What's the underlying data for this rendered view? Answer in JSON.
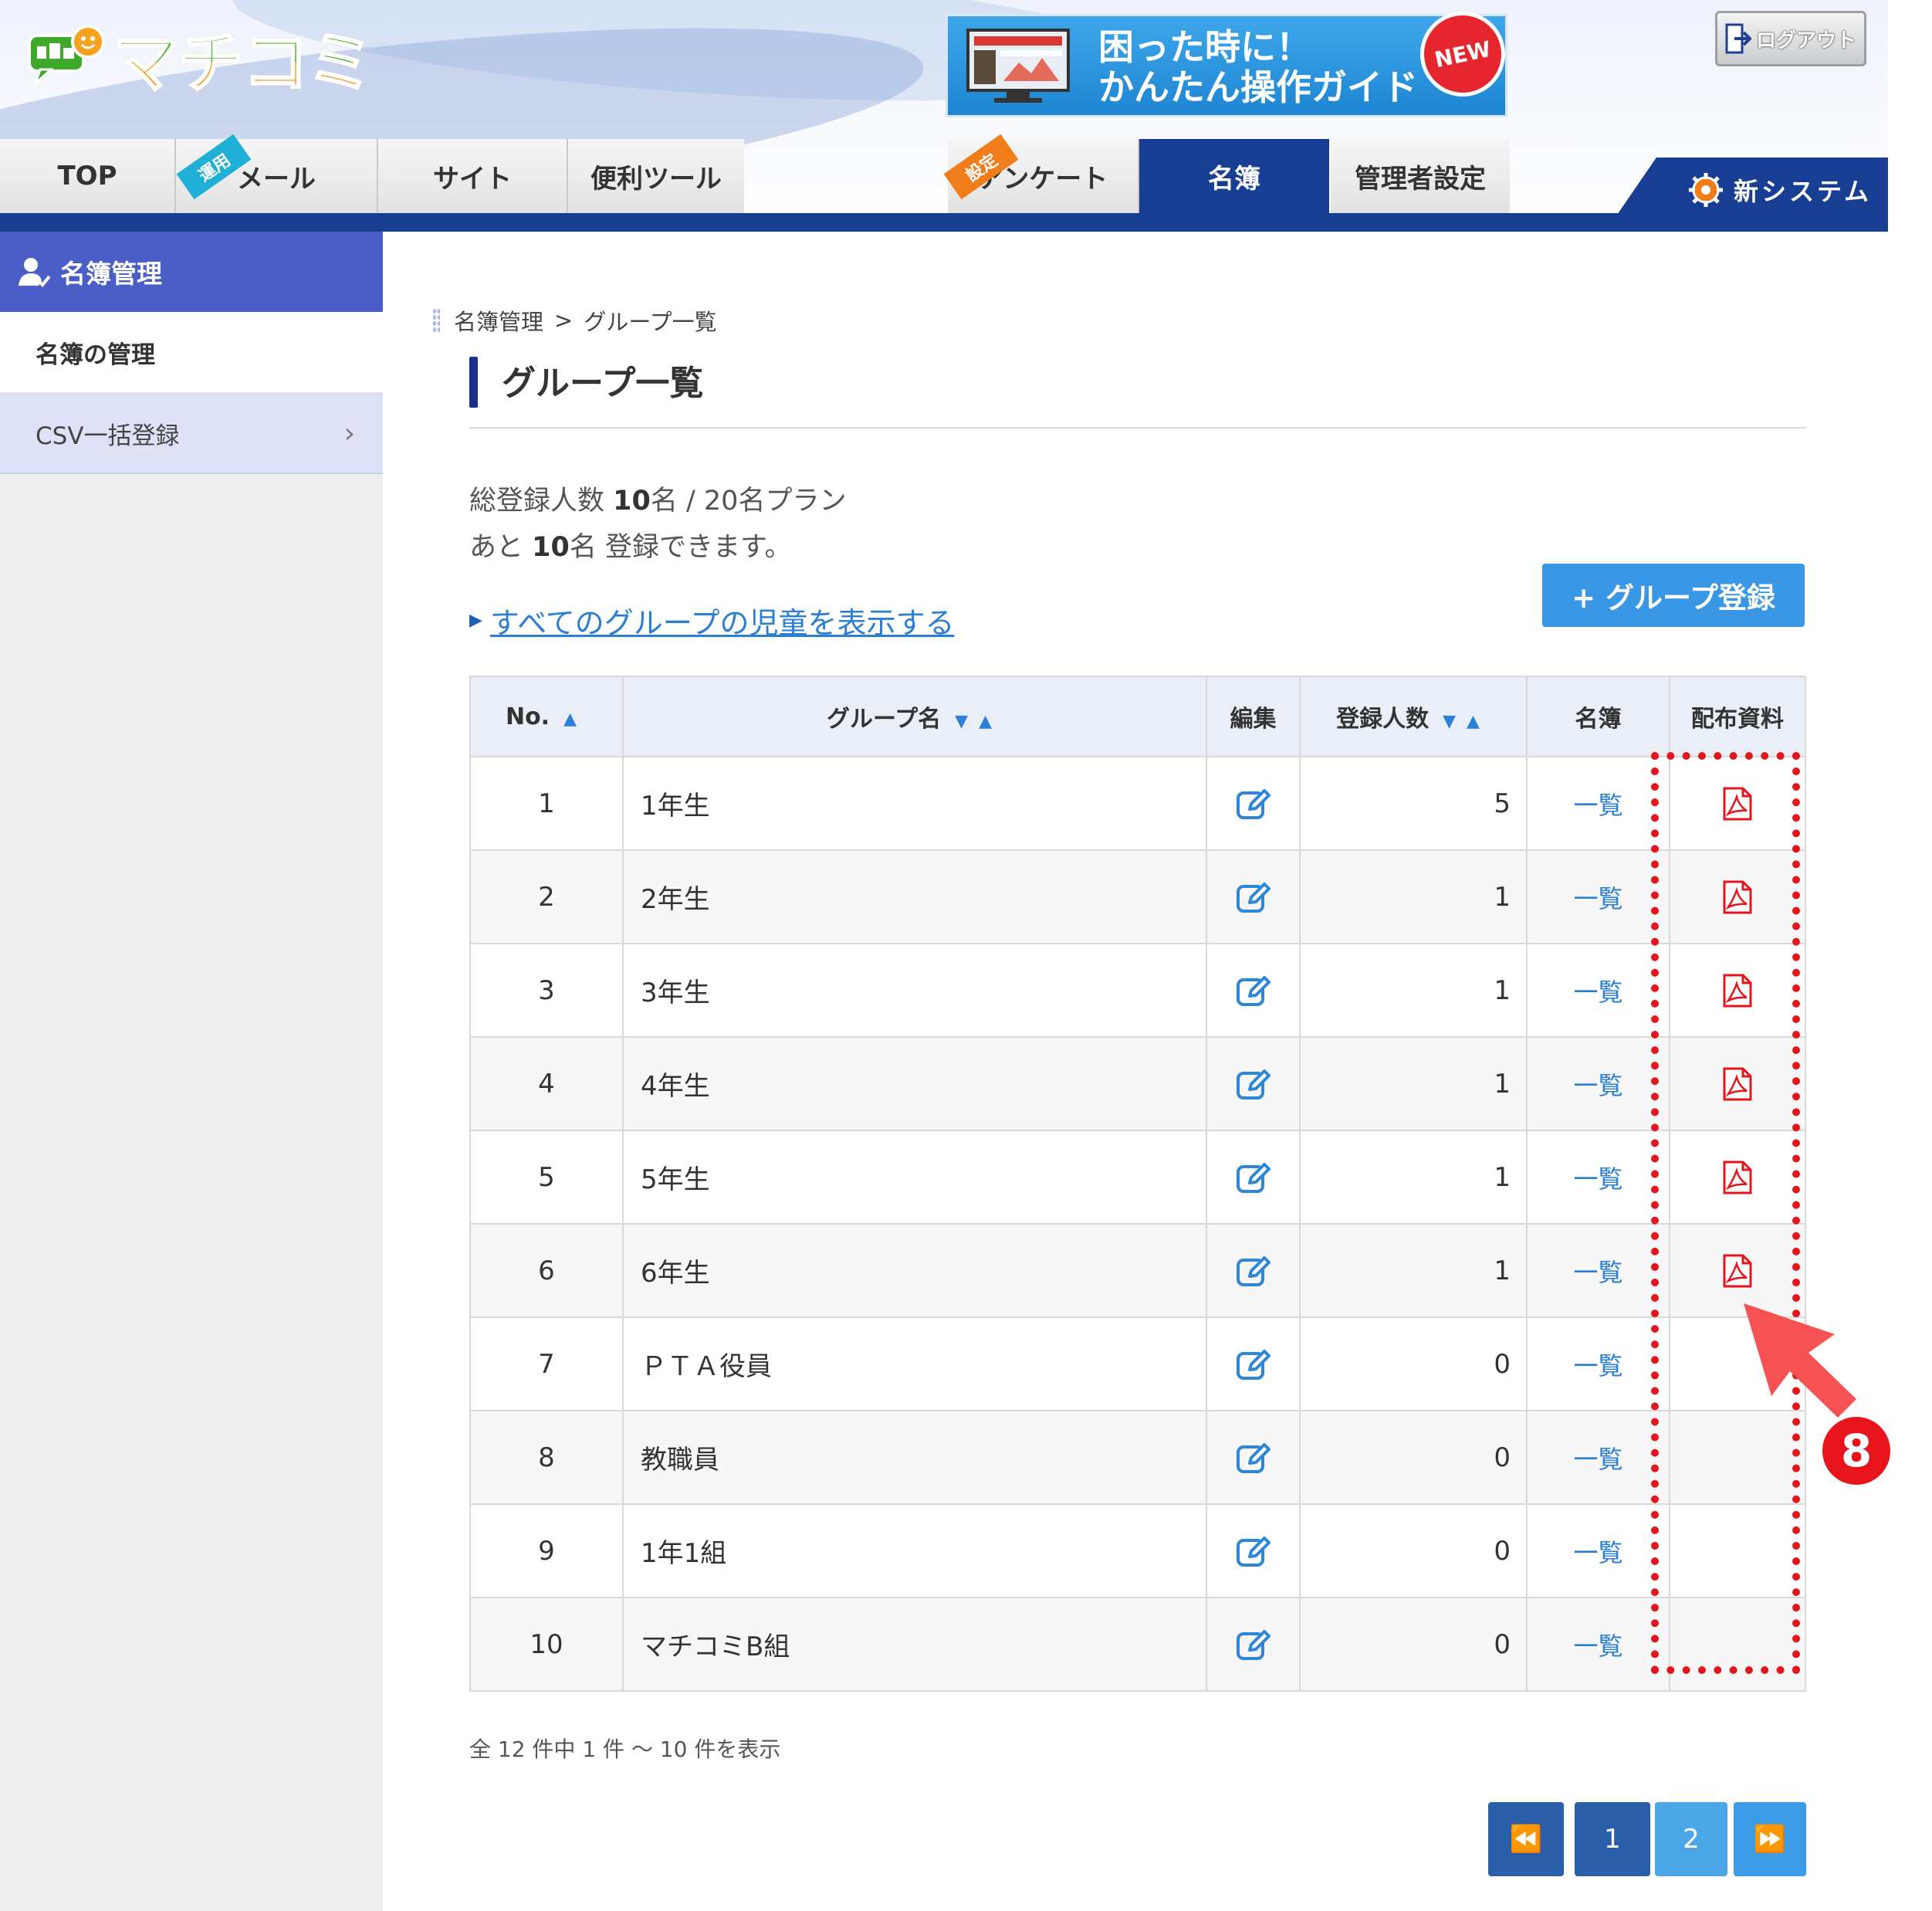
{
  "header": {
    "logo_text": "マチコミ",
    "banner": {
      "line1": "困った時に！",
      "line2": "かんたん操作ガイド",
      "badge": "NEW"
    },
    "logout_label": "ログアウト",
    "nav": {
      "top": "TOP",
      "mail": "メール",
      "mail_ribbon": "運用",
      "site": "サイト",
      "tools": "便利ツール",
      "survey": "アンケート",
      "survey_ribbon": "設定",
      "roster": "名簿",
      "admin": "管理者設定"
    },
    "new_system_label": "新システム"
  },
  "sidebar": {
    "heading": "名簿管理",
    "items": [
      {
        "label": "名簿の管理"
      },
      {
        "label": "CSV一括登録"
      }
    ]
  },
  "main": {
    "breadcrumb": {
      "parent": "名簿管理",
      "separator": ">",
      "current": "グループ一覧"
    },
    "title": "グループ一覧",
    "stats": {
      "line1_prefix": "総登録人数 ",
      "registered": "10",
      "line1_mid": "名 / 20名プラン",
      "line2_prefix": "あと ",
      "remaining": "10",
      "line2_suffix": "名 登録できます。"
    },
    "show_all_link": "すべてのグループの児童を表示する",
    "add_group_label": "+ グループ登録",
    "table": {
      "headers": {
        "no": "No.",
        "name": "グループ名",
        "edit": "編集",
        "count": "登録人数",
        "roster": "名簿",
        "materials": "配布資料"
      },
      "rows": [
        {
          "no": "1",
          "name": "1年生",
          "count": "5",
          "roster": "一覧",
          "pdf": true
        },
        {
          "no": "2",
          "name": "2年生",
          "count": "1",
          "roster": "一覧",
          "pdf": true
        },
        {
          "no": "3",
          "name": "3年生",
          "count": "1",
          "roster": "一覧",
          "pdf": true
        },
        {
          "no": "4",
          "name": "4年生",
          "count": "1",
          "roster": "一覧",
          "pdf": true
        },
        {
          "no": "5",
          "name": "5年生",
          "count": "1",
          "roster": "一覧",
          "pdf": true
        },
        {
          "no": "6",
          "name": "6年生",
          "count": "1",
          "roster": "一覧",
          "pdf": true
        },
        {
          "no": "7",
          "name": "ＰＴＡ役員",
          "count": "0",
          "roster": "一覧",
          "pdf": false
        },
        {
          "no": "8",
          "name": "教職員",
          "count": "0",
          "roster": "一覧",
          "pdf": false
        },
        {
          "no": "9",
          "name": "1年1組",
          "count": "0",
          "roster": "一覧",
          "pdf": false
        },
        {
          "no": "10",
          "name": "マチコミB組",
          "count": "0",
          "roster": "一覧",
          "pdf": false
        }
      ]
    },
    "count_info": "全 12 件中 1 件 ～ 10 件を表示",
    "pagination": {
      "first": "⏪",
      "page1": "1",
      "page2": "2",
      "last": "⏩"
    },
    "annotation_step": "8"
  },
  "colors": {
    "nav_active": "#173e92",
    "sidebar_head": "#4b5ec8",
    "link": "#2a7fd4",
    "primary_button": "#3a97e6",
    "pdf_red": "#e8141c",
    "highlight_red": "#e8141c"
  },
  "icons": {
    "edit": "edit-icon",
    "pdf": "pdf-icon",
    "logout": "logout-icon",
    "gear": "gear-icon",
    "user": "user-icon",
    "chevron": "chevron-right-icon",
    "pointer": "pointer-arrow-icon"
  }
}
